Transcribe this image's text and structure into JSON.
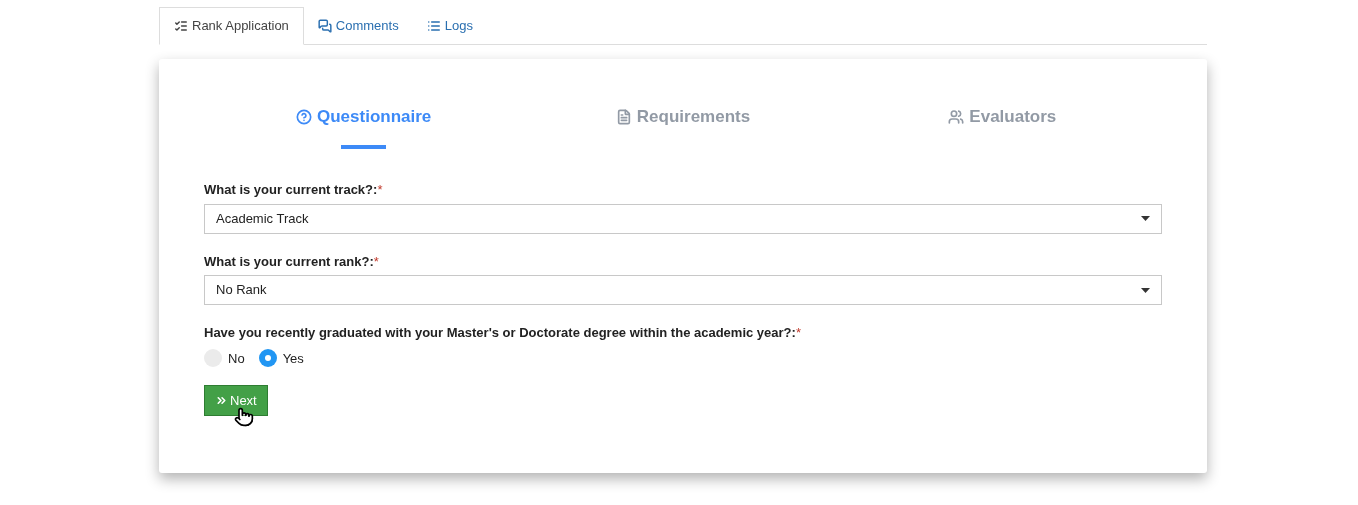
{
  "tabs": [
    {
      "label": "Rank Application",
      "selected": true
    },
    {
      "label": "Comments",
      "selected": false
    },
    {
      "label": "Logs",
      "selected": false
    }
  ],
  "steps": [
    {
      "label": "Questionnaire",
      "selected": true
    },
    {
      "label": "Requirements",
      "selected": false
    },
    {
      "label": "Evaluators",
      "selected": false
    }
  ],
  "questions": [
    {
      "kind": "select",
      "label": "What is your current track?:",
      "required_mark": "*",
      "value": "Academic Track"
    },
    {
      "kind": "select",
      "label": "What is your current rank?:",
      "required_mark": "*",
      "value": "No Rank"
    },
    {
      "kind": "radio",
      "label": "Have you recently graduated with your Master's or Doctorate degree within the academic year?:",
      "required_mark": "*",
      "options": [
        {
          "label": "No",
          "selected": false
        },
        {
          "label": "Yes",
          "selected": true
        }
      ]
    }
  ],
  "next_button": {
    "label": "Next"
  }
}
